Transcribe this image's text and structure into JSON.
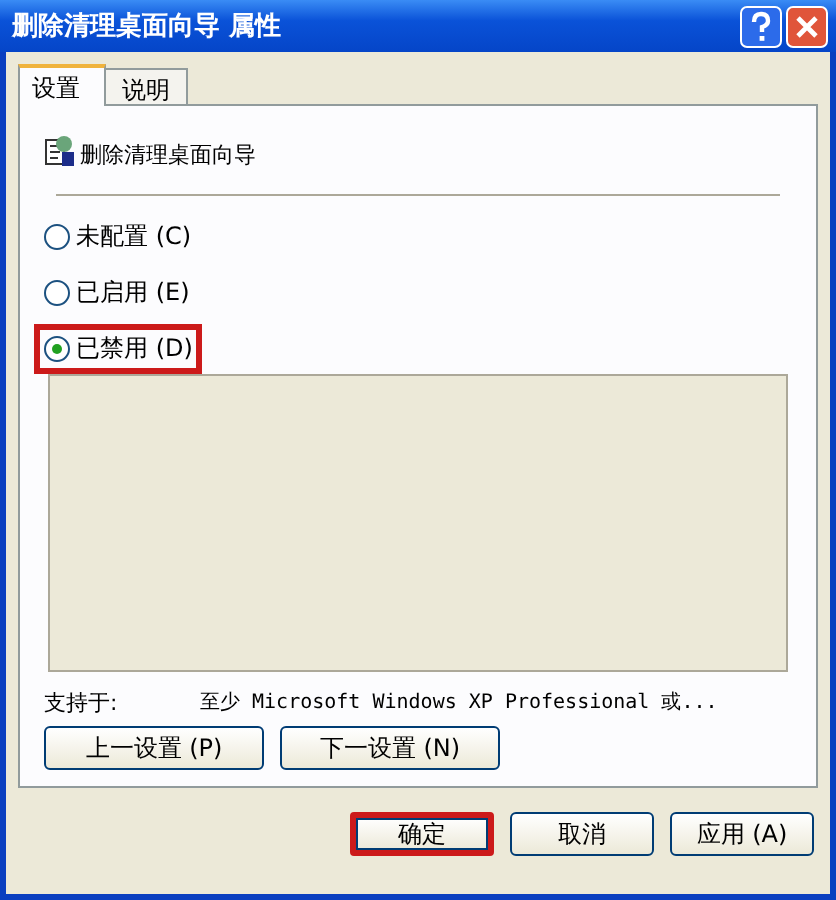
{
  "window": {
    "title": "删除清理桌面向导 属性"
  },
  "tabs": [
    {
      "label": "设置",
      "selected": true
    },
    {
      "label": "说明",
      "selected": false
    }
  ],
  "policy": {
    "title": "删除清理桌面向导"
  },
  "options": [
    {
      "label": "未配置 (C)",
      "selected": false,
      "highlighted": false
    },
    {
      "label": "已启用 (E)",
      "selected": false,
      "highlighted": false
    },
    {
      "label": "已禁用 (D)",
      "selected": true,
      "highlighted": true
    }
  ],
  "supported": {
    "label": "支持于:",
    "value": "至少 Microsoft Windows XP Professional 或..."
  },
  "nav_buttons": [
    "上一设置 (P)",
    "下一设置 (N)"
  ],
  "dialog_buttons": [
    {
      "label": "确定",
      "highlighted": true
    },
    {
      "label": "取消",
      "highlighted": false
    },
    {
      "label": "应用 (A)",
      "highlighted": false
    }
  ]
}
